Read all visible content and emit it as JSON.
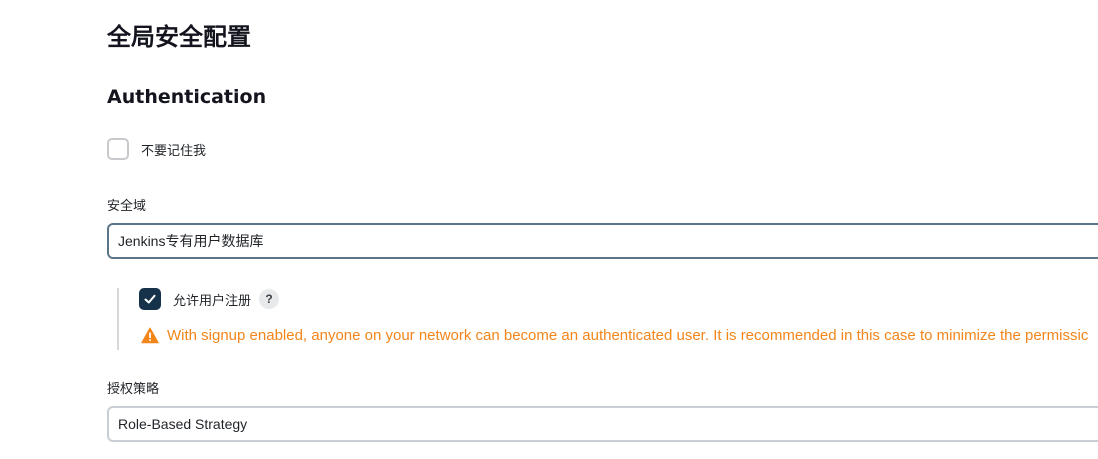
{
  "page": {
    "title": "全局安全配置"
  },
  "authentication": {
    "heading": "Authentication",
    "disable_remember_me": {
      "label": "不要记住我",
      "checked": false
    }
  },
  "security_realm": {
    "label": "安全域",
    "selected": "Jenkins专有用户数据库",
    "allow_signup": {
      "label": "允许用户注册",
      "checked": true,
      "help": "?"
    },
    "warning": "With signup enabled, anyone on your network can become an authenticated user. It is recommended in this case to minimize the permissic"
  },
  "authorization": {
    "label": "授权策略",
    "selected": "Role-Based Strategy"
  },
  "colors": {
    "accent": "#16324a",
    "warning": "#f38519"
  }
}
